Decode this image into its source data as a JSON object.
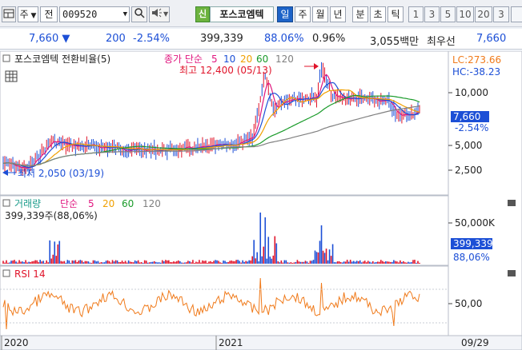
{
  "toolbar": {
    "btn_ju": "주",
    "btn_jeon": "전",
    "stock_code": "009520",
    "stock_name": "포스코엠텍",
    "badge_sin": "신",
    "periods": [
      "일",
      "주",
      "월",
      "년",
      "분",
      "초",
      "틱"
    ],
    "selected_period": "일",
    "numbers": [
      "1",
      "3",
      "5",
      "10",
      "20",
      "3"
    ]
  },
  "quote": {
    "price": "7,660",
    "change": "200",
    "change_pct": "-2.54%",
    "volume": "399,339",
    "volume_ratio": "88.06%",
    "turnover_pct": "0.96%",
    "amount": "3,055백만",
    "priority_label": "최우선",
    "priority_price": "7,660"
  },
  "price_panel": {
    "title": "포스코엠텍 전환비율(5)",
    "ma_label": "종가 단순",
    "ma_periods": [
      "5",
      "10",
      "20",
      "60",
      "120"
    ],
    "ma_colors": [
      "#e0167f",
      "#1c4fd6",
      "#f0a000",
      "#1a9b2a",
      "#808080"
    ],
    "high_label": "최고 12,400 (05/13)",
    "low_label": "최저 2,050 (03/19)",
    "lc": "LC:273.66",
    "hc": "HC:-38.23",
    "y_ticks": [
      "10,000",
      "5,000",
      "2,500"
    ],
    "cur_price": "7,660",
    "cur_change": "-2.54%"
  },
  "volume_panel": {
    "title": "거래량",
    "ma_label": "단순",
    "ma_periods": [
      "5",
      "20",
      "60",
      "120"
    ],
    "value_text": "399,339주(88,06%)",
    "y_tick": "50,000K",
    "cur_vol": "399,339",
    "cur_pct": "88,06%"
  },
  "rsi_panel": {
    "title": "RSI 14",
    "y_tick": "50,00"
  },
  "x_axis": {
    "labels": [
      "2020",
      "2021",
      "09/29"
    ]
  },
  "colors": {
    "up": "#e0142a",
    "down": "#1c4fd6",
    "rsi": "#f07a1a",
    "current_box": "#1c4fd6"
  }
}
